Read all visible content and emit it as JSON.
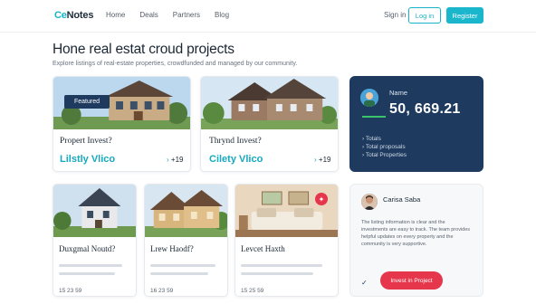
{
  "brand": {
    "logo_prefix": "Ce",
    "logo_rest": "Notes"
  },
  "nav": {
    "links": [
      "Home",
      "Deals",
      "Partners",
      "Blog"
    ],
    "login": "Sign in",
    "login_button": "Log in",
    "signup_button": "Register"
  },
  "hero": {
    "title": "Hone real estat croud projects",
    "subtitle": "Explore listings of real-estate properties, crowdfunded and managed by our community."
  },
  "projects_top": [
    {
      "badge": "Featured",
      "title": "Propert Invest?",
      "stat": "Lilstly Vlico",
      "count": "+19"
    },
    {
      "title": "Thrynd Invest?",
      "stat": "Cilety Vlico",
      "count": "+19"
    }
  ],
  "projects_bottom": [
    {
      "title": "Duxgmal Noutd?",
      "meta": "15   23   59"
    },
    {
      "title": "Lrew Haodf?",
      "meta": "16   23   59"
    },
    {
      "title": "Levcet Haxth",
      "meta": "15   25   59"
    }
  ],
  "investor": {
    "name": "Name",
    "amount": "50, 669.21",
    "lines": [
      "Totals",
      "Total proposals",
      "Total Properties"
    ]
  },
  "review": {
    "name": "Carisa Saba",
    "text": "The listing information is clear and the investments are easy to track. The team provides helpful updates on every property and the community is very supportive.",
    "check": "✓",
    "cta": "Invest in Project"
  },
  "colors": {
    "accent": "#19b6cc",
    "navy": "#1e3a5f",
    "cta": "#e5364b"
  }
}
